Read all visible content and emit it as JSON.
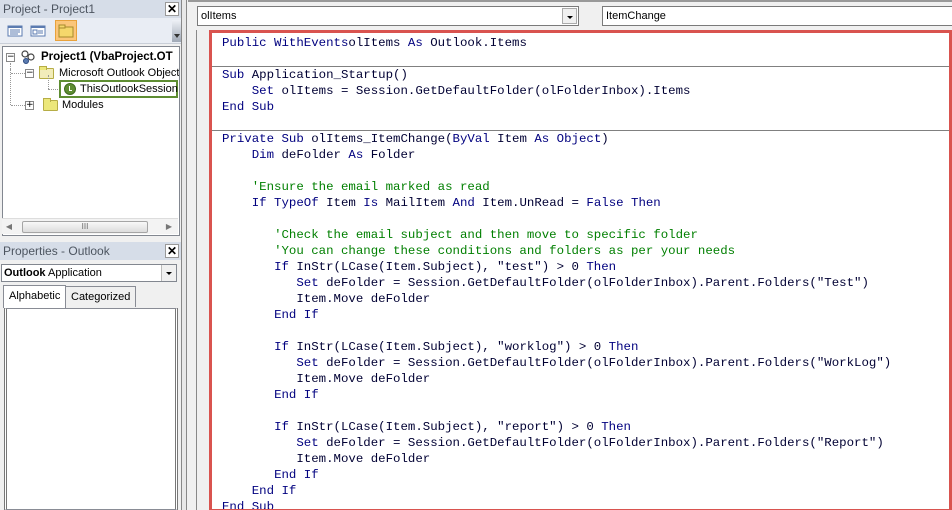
{
  "project_pane": {
    "title": "Project - Project1",
    "toolbar": [
      {
        "name": "view-code",
        "icon": "view-code-icon"
      },
      {
        "name": "view-object",
        "icon": "view-object-icon"
      },
      {
        "name": "toggle-folders",
        "icon": "folder-icon",
        "active": true
      }
    ],
    "tree": {
      "root": "Project1 (VbaProject.OT",
      "objects_folder": "Microsoft Outlook Object",
      "selected_item": "ThisOutlookSession",
      "modules_folder": "Modules"
    },
    "scroll_thumb": "III"
  },
  "properties_pane": {
    "title": "Properties - Outlook",
    "object_name": "Outlook",
    "object_type": "Application",
    "tabs": [
      "Alphabetic",
      "Categorized"
    ],
    "active_tab": "Alphabetic"
  },
  "code_window": {
    "object_combo": "olItems",
    "procedure_combo": "ItemChange",
    "highlight_color": "#d9534f",
    "lines": [
      {
        "indent": 0,
        "tokens": [
          [
            "kw",
            "Public WithEvents"
          ],
          [
            "",
            "olItems"
          ],
          [
            "kw",
            " As"
          ],
          [
            "",
            " Outlook.Items"
          ]
        ]
      },
      {
        "indent": 0,
        "tokens": []
      },
      {
        "indent": 0,
        "tokens": [
          [
            "kw",
            "Sub"
          ],
          [
            "",
            " Application_Startup()"
          ]
        ]
      },
      {
        "indent": 4,
        "tokens": [
          [
            "kw",
            "Set"
          ],
          [
            "",
            " olItems = Session.GetDefaultFolder(olFolderInbox).Items"
          ]
        ]
      },
      {
        "indent": 0,
        "tokens": [
          [
            "kw",
            "End Sub"
          ]
        ]
      },
      {
        "indent": 0,
        "tokens": []
      },
      {
        "indent": 0,
        "tokens": [
          [
            "kw",
            "Private Sub"
          ],
          [
            "",
            " olItems_ItemChange("
          ],
          [
            "kw",
            "ByVal"
          ],
          [
            "",
            " Item "
          ],
          [
            "kw",
            "As Object"
          ],
          [
            "",
            ")"
          ]
        ]
      },
      {
        "indent": 4,
        "tokens": [
          [
            "kw",
            "Dim"
          ],
          [
            "",
            " deFolder "
          ],
          [
            "kw",
            "As"
          ],
          [
            "",
            " Folder"
          ]
        ]
      },
      {
        "indent": 0,
        "tokens": []
      },
      {
        "indent": 4,
        "tokens": [
          [
            "cm",
            "'Ensure the email marked as read"
          ]
        ]
      },
      {
        "indent": 4,
        "tokens": [
          [
            "kw",
            "If TypeOf"
          ],
          [
            "",
            " Item "
          ],
          [
            "kw",
            "Is"
          ],
          [
            "",
            " MailItem "
          ],
          [
            "kw",
            "And"
          ],
          [
            "",
            " Item.UnRead = "
          ],
          [
            "kw",
            "False Then"
          ]
        ]
      },
      {
        "indent": 0,
        "tokens": []
      },
      {
        "indent": 7,
        "tokens": [
          [
            "cm",
            "'Check the email subject and then move to specific folder"
          ]
        ]
      },
      {
        "indent": 7,
        "tokens": [
          [
            "cm",
            "'You can change these conditions and folders as per your needs"
          ]
        ]
      },
      {
        "indent": 7,
        "tokens": [
          [
            "kw",
            "If"
          ],
          [
            "",
            " InStr(LCase(Item.Subject), \"test\") > 0 "
          ],
          [
            "kw",
            "Then"
          ]
        ]
      },
      {
        "indent": 10,
        "tokens": [
          [
            "kw",
            "Set"
          ],
          [
            "",
            " deFolder = Session.GetDefaultFolder(olFolderInbox).Parent.Folders(\"Test\")"
          ]
        ]
      },
      {
        "indent": 10,
        "tokens": [
          [
            "",
            "Item.Move deFolder"
          ]
        ]
      },
      {
        "indent": 7,
        "tokens": [
          [
            "kw",
            "End If"
          ]
        ]
      },
      {
        "indent": 0,
        "tokens": []
      },
      {
        "indent": 7,
        "tokens": [
          [
            "kw",
            "If"
          ],
          [
            "",
            " InStr(LCase(Item.Subject), \"worklog\") > 0 "
          ],
          [
            "kw",
            "Then"
          ]
        ]
      },
      {
        "indent": 10,
        "tokens": [
          [
            "kw",
            "Set"
          ],
          [
            "",
            " deFolder = Session.GetDefaultFolder(olFolderInbox).Parent.Folders(\"WorkLog\")"
          ]
        ]
      },
      {
        "indent": 10,
        "tokens": [
          [
            "",
            "Item.Move deFolder"
          ]
        ]
      },
      {
        "indent": 7,
        "tokens": [
          [
            "kw",
            "End If"
          ]
        ]
      },
      {
        "indent": 0,
        "tokens": []
      },
      {
        "indent": 7,
        "tokens": [
          [
            "kw",
            "If"
          ],
          [
            "",
            " InStr(LCase(Item.Subject), \"report\") > 0 "
          ],
          [
            "kw",
            "Then"
          ]
        ]
      },
      {
        "indent": 10,
        "tokens": [
          [
            "kw",
            "Set"
          ],
          [
            "",
            " deFolder = Session.GetDefaultFolder(olFolderInbox).Parent.Folders(\"Report\")"
          ]
        ]
      },
      {
        "indent": 10,
        "tokens": [
          [
            "",
            "Item.Move deFolder"
          ]
        ]
      },
      {
        "indent": 7,
        "tokens": [
          [
            "kw",
            "End If"
          ]
        ]
      },
      {
        "indent": 4,
        "tokens": [
          [
            "kw",
            "End If"
          ]
        ]
      },
      {
        "indent": 0,
        "tokens": [
          [
            "kw",
            "End Sub"
          ]
        ]
      }
    ],
    "procedure_separators_after_line": [
      1,
      5
    ]
  }
}
